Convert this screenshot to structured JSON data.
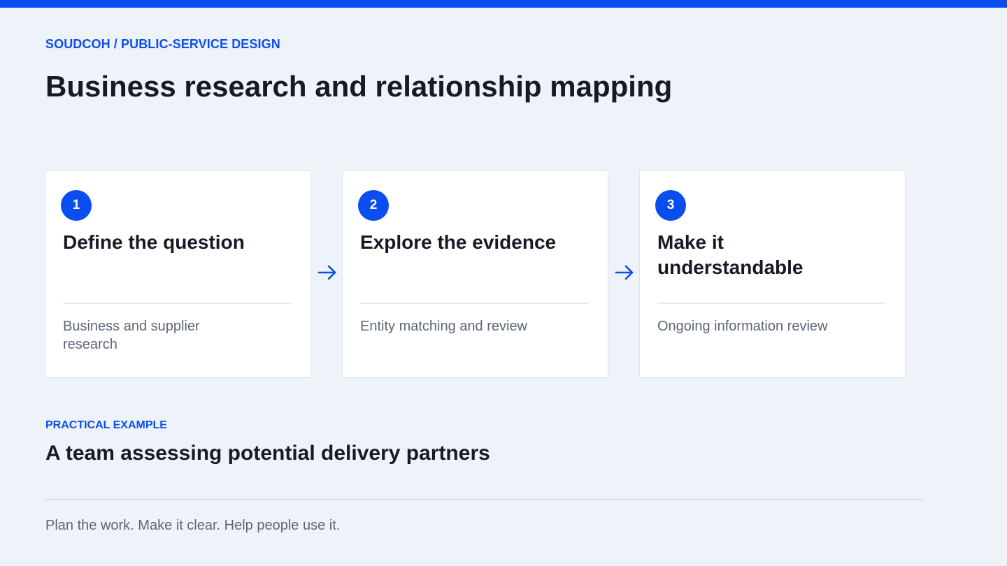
{
  "header": {
    "eyebrow": "SOUDCOH / PUBLIC-SERVICE DESIGN",
    "title": "Business research and relationship mapping"
  },
  "steps": [
    {
      "number": "1",
      "title": "Define the question",
      "description": "Business and supplier research"
    },
    {
      "number": "2",
      "title": "Explore the evidence",
      "description": "Entity matching and review"
    },
    {
      "number": "3",
      "title": "Make it understandable",
      "description": "Ongoing information review"
    }
  ],
  "example": {
    "kicker": "PRACTICAL EXAMPLE",
    "title": "A team assessing potential delivery partners"
  },
  "footer": {
    "tagline": "Plan the work. Make it clear. Help people use it."
  },
  "colors": {
    "accent": "#0b4ef0",
    "background": "#eef2f9",
    "card": "#ffffff",
    "text": "#151a24",
    "muted": "#5d6677"
  },
  "icons": {
    "connector": "arrow-right-icon"
  }
}
